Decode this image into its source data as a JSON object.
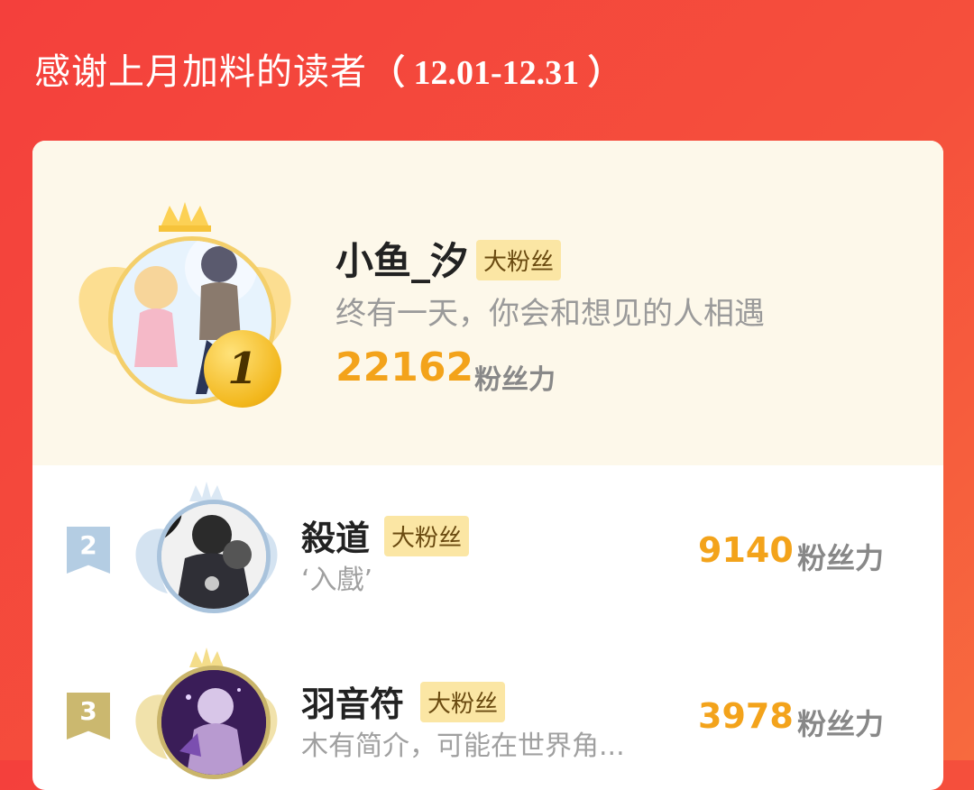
{
  "header": {
    "title": "感谢上月加料的读者",
    "date_range": "（ 12.01-12.31 ）"
  },
  "ranking": [
    {
      "rank": "1",
      "name": "小鱼_汐",
      "badge": "大粉丝",
      "bio": "终有一天，你会和想见的人相遇",
      "points": "22162",
      "unit": "粉丝力"
    },
    {
      "rank": "2",
      "name": "殺道",
      "badge": "大粉丝",
      "bio": "‘入戲’",
      "points": "9140",
      "unit": "粉丝力"
    },
    {
      "rank": "3",
      "name": "羽音符",
      "badge": "大粉丝",
      "bio": "木有简介，可能在世界角...",
      "points": "3978",
      "unit": "粉丝力"
    }
  ],
  "colors": {
    "header_bg": "#f4403c",
    "points": "#f3a31b",
    "badge_bg": "#fbe6a4",
    "gold": "#f2b71c",
    "silver": "#a9c3dc",
    "bronze": "#c9b46a"
  }
}
